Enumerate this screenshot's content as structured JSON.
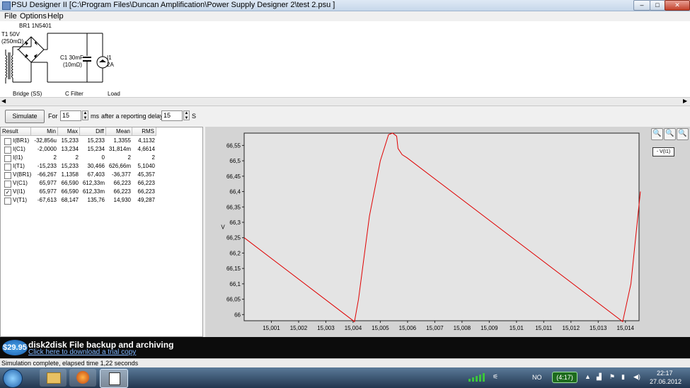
{
  "window": {
    "title": "PSU Designer II  [C:\\Program Files\\Duncan Amplification\\Power Supply Designer 2\\test 2.psu ]",
    "minimize": "–",
    "maximize": "□",
    "close": "✕"
  },
  "menu": [
    "File",
    "Options",
    "Help"
  ],
  "schematic": {
    "bridge_label": "BR1 1N5401",
    "transformer_label_1": "T1 50V",
    "transformer_label_2": "(250mΩ)",
    "cap_label_1": "C1 30mF",
    "cap_label_2": "(10mΩ)",
    "load_label_1": "I1",
    "load_label_2": "2A",
    "section_1": "Bridge (SS)",
    "section_2": "C Filter",
    "section_3": "Load"
  },
  "simulation": {
    "button": "Simulate",
    "for_label": "For",
    "duration": "15",
    "duration_unit": "ms",
    "delay_label": "after a reporting delay of",
    "delay": "15",
    "delay_unit": "S"
  },
  "results": {
    "headers": [
      "Result",
      "Min",
      "Max",
      "Diff",
      "Mean",
      "RMS"
    ],
    "rows": [
      {
        "checked": false,
        "name": "I(BR1)",
        "min": "-32,856u",
        "max": "15,233",
        "diff": "15,233",
        "mean": "1,3355",
        "rms": "4,1132"
      },
      {
        "checked": false,
        "name": "I(C1)",
        "min": "-2,0000",
        "max": "13,234",
        "diff": "15,234",
        "mean": "31,814m",
        "rms": "4,6614"
      },
      {
        "checked": false,
        "name": "I(I1)",
        "min": "2",
        "max": "2",
        "diff": "0",
        "mean": "2",
        "rms": "2"
      },
      {
        "checked": false,
        "name": "I(T1)",
        "min": "-15,233",
        "max": "15,233",
        "diff": "30,466",
        "mean": "626,66m",
        "rms": "5,1040"
      },
      {
        "checked": false,
        "name": "V(BR1)",
        "min": "-66,267",
        "max": "1,1358",
        "diff": "67,403",
        "mean": "-36,377",
        "rms": "45,357"
      },
      {
        "checked": false,
        "name": "V(C1)",
        "min": "65,977",
        "max": "66,590",
        "diff": "612,33m",
        "mean": "66,223",
        "rms": "66,223"
      },
      {
        "checked": true,
        "name": "V(I1)",
        "min": "65,977",
        "max": "66,590",
        "diff": "612,33m",
        "mean": "66,223",
        "rms": "66,223"
      },
      {
        "checked": false,
        "name": "V(T1)",
        "min": "-67,613",
        "max": "68,147",
        "diff": "135,76",
        "mean": "14,930",
        "rms": "49,287"
      }
    ]
  },
  "plot_toolbar": {
    "zoom_in": "🔍",
    "zoom_out": "🔍",
    "zoom_reset": "🔍"
  },
  "chart_data": {
    "type": "line",
    "ylabel": "V",
    "xlim": [
      15.0,
      15.0145
    ],
    "ylim": [
      65.98,
      66.59
    ],
    "x_ticks": [
      "15,001",
      "15,002",
      "15,003",
      "15,004",
      "15,005",
      "15,006",
      "15,007",
      "15,008",
      "15,009",
      "15,01",
      "15,011",
      "15,012",
      "15,013",
      "15,014"
    ],
    "x_tick_values": [
      15.001,
      15.002,
      15.003,
      15.004,
      15.005,
      15.006,
      15.007,
      15.008,
      15.009,
      15.01,
      15.011,
      15.012,
      15.013,
      15.014
    ],
    "y_ticks": [
      "66,55",
      "66,5",
      "66,45",
      "66,4",
      "66,35",
      "66,3",
      "66,25",
      "66,2",
      "66,15",
      "66,1",
      "66,05",
      "66"
    ],
    "y_tick_values": [
      66.55,
      66.5,
      66.45,
      66.4,
      66.35,
      66.3,
      66.25,
      66.2,
      66.15,
      66.1,
      66.05,
      66.0
    ],
    "grid": false,
    "legend": "top-right",
    "series": [
      {
        "name": "- V(I1)",
        "color": "#e00000",
        "x": [
          15.0,
          15.00405,
          15.0042,
          15.0046,
          15.005,
          15.0053,
          15.00545,
          15.0056,
          15.00565,
          15.0058,
          15.00598,
          15.0139,
          15.0142,
          15.01455
        ],
        "y": [
          66.25,
          65.977,
          66.05,
          66.32,
          66.5,
          66.585,
          66.59,
          66.58,
          66.54,
          66.52,
          66.51,
          65.977,
          66.1,
          66.4
        ]
      }
    ]
  },
  "banner": {
    "price": "$29.95",
    "headline": "disk2disk File backup and archiving",
    "link": "Click here to download a trial copy"
  },
  "status": "Simulation complete, elapsed time 1,22 seconds",
  "taskbar": {
    "lang": "NO",
    "battery": "(4:17)",
    "time": "22:17",
    "date": "27.06.2012"
  }
}
